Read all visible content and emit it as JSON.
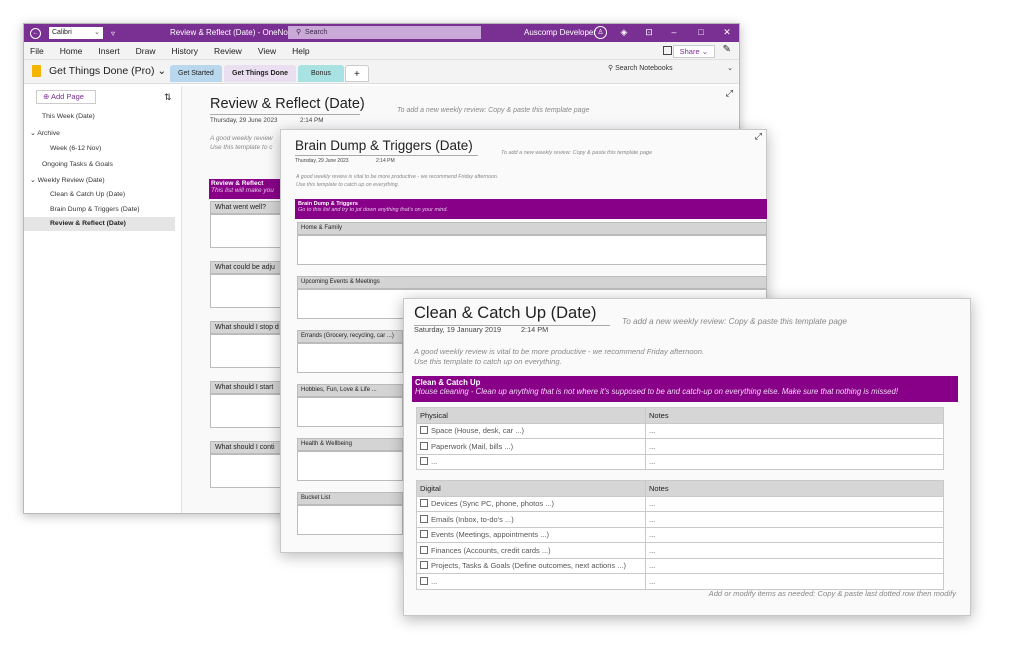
{
  "titlebar": {
    "font": "Calibri",
    "window_title": "Review & Reflect (Date)  -  OneNote",
    "search": "Search",
    "user": "Auscomp Developer"
  },
  "menu": [
    "File",
    "Home",
    "Insert",
    "Draw",
    "History",
    "Review",
    "View",
    "Help"
  ],
  "share": "Share",
  "notebook": {
    "name": "Get Things Done (Pro)",
    "tabs": [
      {
        "label": "Get Started",
        "color": "#b9d8ee"
      },
      {
        "label": "Get Things Done",
        "color": "#e9dff0"
      },
      {
        "label": "Bonus",
        "color": "#a9e2e3"
      }
    ],
    "add": "+",
    "search": "Search Notebooks"
  },
  "sidebar": {
    "add_page": "Add Page",
    "pages": [
      "This Week (Date)",
      "Archive",
      "Week (6-12 Nov)",
      "Ongoing Tasks & Goals",
      "Weekly Review (Date)",
      "Clean & Catch Up (Date)",
      "Brain Dump & Triggers (Date)",
      "Review & Reflect (Date)"
    ]
  },
  "page1": {
    "title": "Review & Reflect (Date)",
    "date": "Thursday, 29 June 2023",
    "time": "2:14 PM",
    "hint": "To add a new weekly review: Copy & paste this template page",
    "intro1": "A good weekly review",
    "intro2": "Use this template to c",
    "banner_title": "Review & Reflect",
    "banner_sub": "This list will make you",
    "questions": [
      "What went well?",
      "What could be adju",
      "What should I stop d",
      "What should I start",
      "What should I conti"
    ]
  },
  "page2": {
    "title": "Brain Dump & Triggers (Date)",
    "date": "Thursday, 29 June 2023",
    "time": "2:14 PM",
    "hint": "To add a new weekly review: Copy & paste this template page",
    "intro1": "A good weekly review is vital to be more productive - we recommend Friday afternoon.",
    "intro2": "Use this template to catch up on everything.",
    "banner_title": "Brain Dump & Triggers",
    "banner_sub": "Go to this list and try to jot down anything that's on your mind.",
    "sections": [
      "Home & Family",
      "Upcoming Events & Meetings",
      "Errands (Grocery, recycling, car ...)",
      "Hobbies, Fun, Love & Life ...",
      "Health & Wellbeing",
      "Bucket List"
    ]
  },
  "page3": {
    "title": "Clean & Catch Up (Date)",
    "date": "Saturday, 19 January 2019",
    "time": "2:14 PM",
    "hint": "To add a new weekly review: Copy & paste this template page",
    "intro1": "A good weekly review is vital to be more productive - we recommend Friday afternoon.",
    "intro2": "Use this template to catch up on everything.",
    "banner_title": "Clean & Catch Up",
    "banner_sub": "House cleaning - Clean up anything that is not where it's supposed to be and catch-up on everything else. Make sure that nothing is missed!",
    "table1": {
      "col1": "Physical",
      "col2": "Notes",
      "rows": [
        [
          "Space (House, desk, car ...)",
          "..."
        ],
        [
          "Paperwork (Mail, bills ...)",
          "..."
        ],
        [
          "...",
          "..."
        ]
      ]
    },
    "table2": {
      "col1": "Digital",
      "col2": "Notes",
      "rows": [
        [
          "Devices (Sync PC, phone, photos ...)",
          "..."
        ],
        [
          "Emails (Inbox, to-do's ...)",
          "..."
        ],
        [
          "Events (Meetings, appointments ...)",
          "..."
        ],
        [
          "Finances (Accounts, credit cards ...)",
          "..."
        ],
        [
          "Projects, Tasks & Goals (Define outcomes, next actions ...)",
          "..."
        ],
        [
          "...",
          "..."
        ]
      ]
    },
    "footer": "Add or modify items as needed: Copy & paste last dotted row then modify"
  }
}
